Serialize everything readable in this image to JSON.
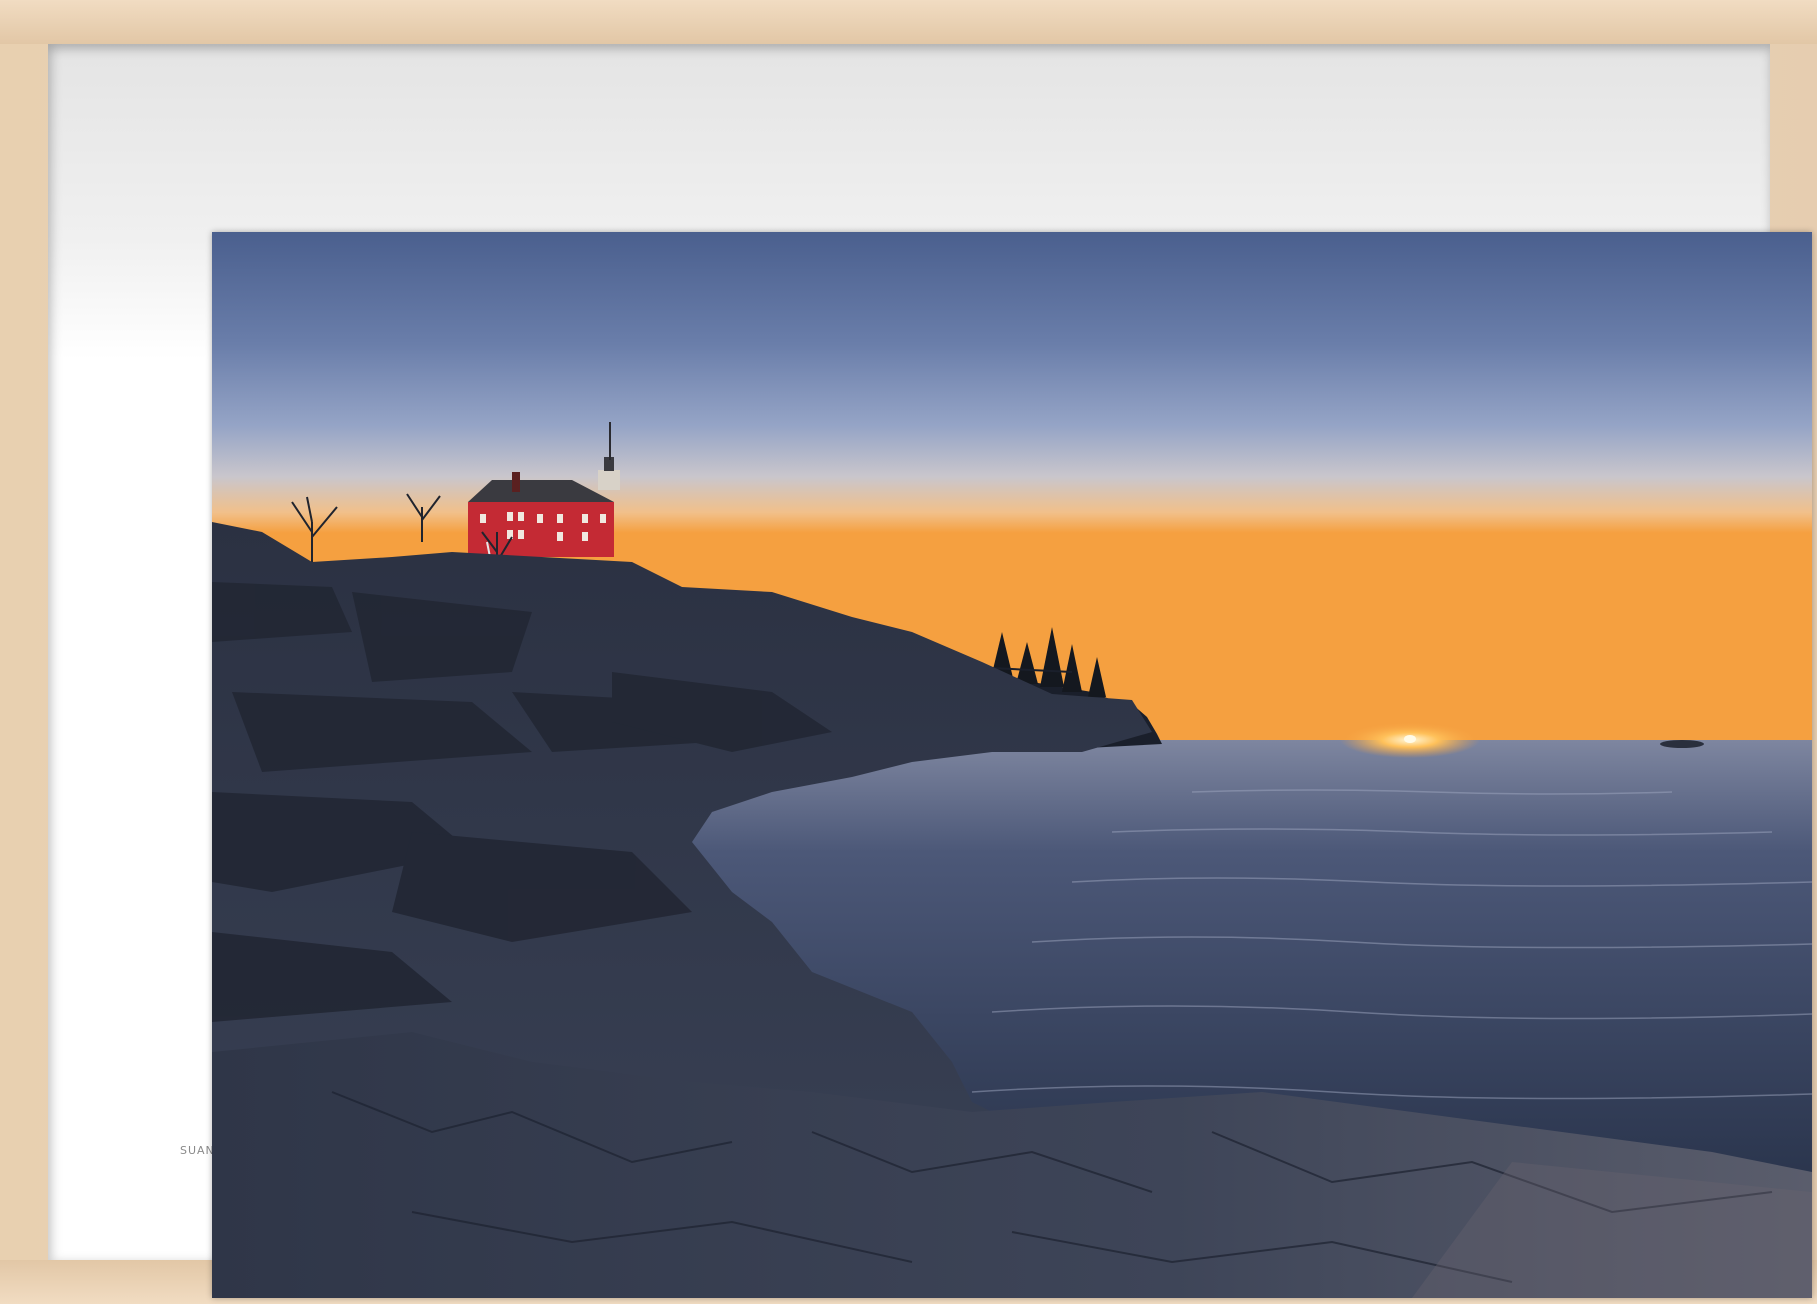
{
  "artwork": {
    "signature": "SUAN",
    "subject": "lighthouse-sunset"
  },
  "colors": {
    "frame_wood": "#e8d0b0",
    "mat": "#ffffff",
    "sky_top": "#4a5f8e",
    "sky_mid": "#8c9cc0",
    "horizon_glow": "#f5a040",
    "lighthouse_red": "#c42a34",
    "water": "#2e3a55"
  }
}
